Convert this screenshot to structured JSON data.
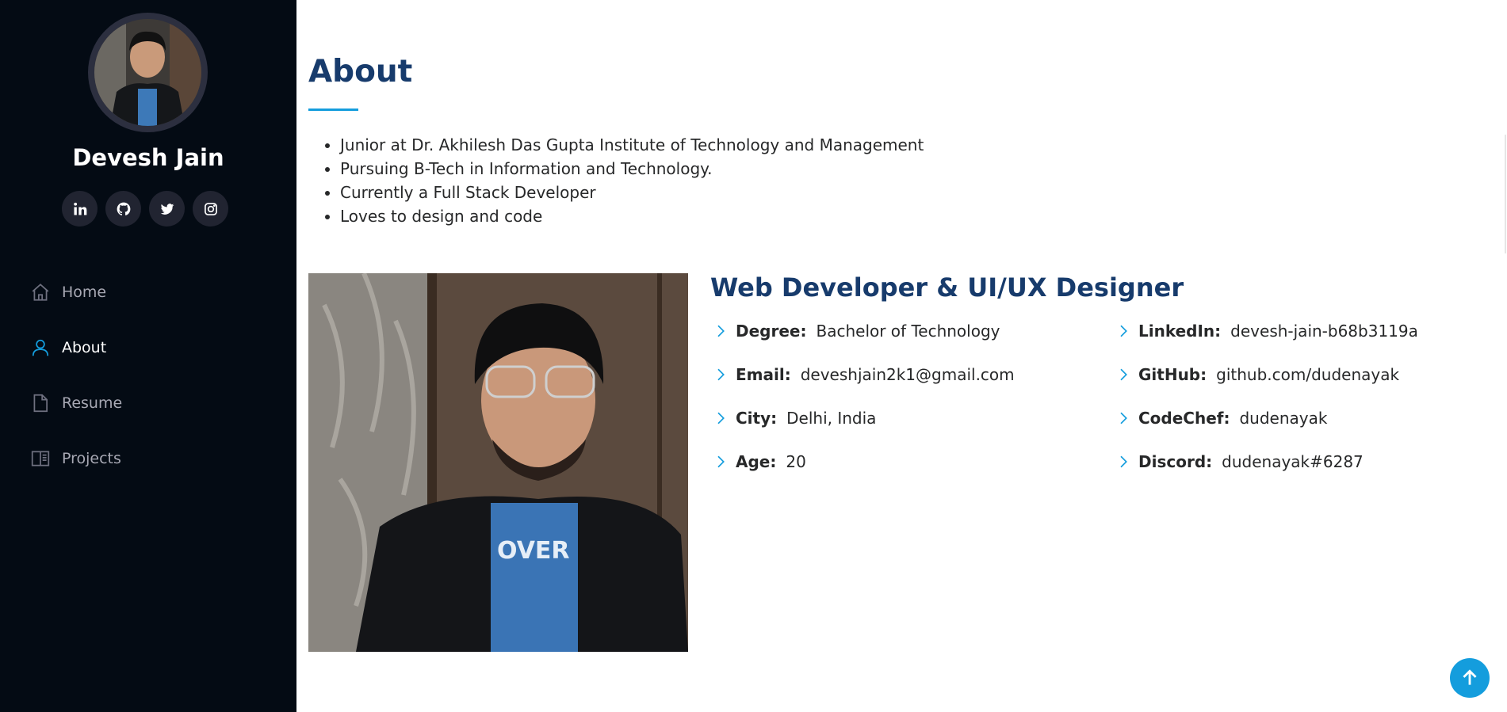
{
  "sidebar": {
    "name": "Devesh Jain",
    "avatar_icon": "profile-photo",
    "socials": [
      {
        "icon": "linkedin-icon"
      },
      {
        "icon": "github-icon"
      },
      {
        "icon": "twitter-icon"
      },
      {
        "icon": "instagram-icon"
      }
    ],
    "nav": [
      {
        "label": "Home",
        "icon": "home-icon",
        "active": false
      },
      {
        "label": "About",
        "icon": "user-icon",
        "active": true
      },
      {
        "label": "Resume",
        "icon": "file-icon",
        "active": false
      },
      {
        "label": "Projects",
        "icon": "book-icon",
        "active": false
      }
    ]
  },
  "about": {
    "title": "About",
    "bullets": [
      "Junior at Dr. Akhilesh Das Gupta Institute of Technology and Management",
      "Pursuing B-Tech in Information and Technology.",
      "Currently a Full Stack Developer",
      "Loves to design and code"
    ],
    "role": "Web Developer & UI/UX Designer",
    "info_left": [
      {
        "label": "Degree:",
        "value": "Bachelor of Technology"
      },
      {
        "label": "Email:",
        "value": "deveshjain2k1@gmail.com"
      },
      {
        "label": "City:",
        "value": "Delhi, India"
      },
      {
        "label": "Age:",
        "value": "20"
      }
    ],
    "info_right": [
      {
        "label": "LinkedIn:",
        "value": "devesh-jain-b68b3119a"
      },
      {
        "label": "GitHub:",
        "value": "github.com/dudenayak"
      },
      {
        "label": "CodeChef:",
        "value": "dudenayak"
      },
      {
        "label": "Discord:",
        "value": "dudenayak#6287"
      }
    ]
  },
  "colors": {
    "sidebar_bg": "#040b14",
    "accent": "#149ddd",
    "heading": "#173b6c"
  }
}
